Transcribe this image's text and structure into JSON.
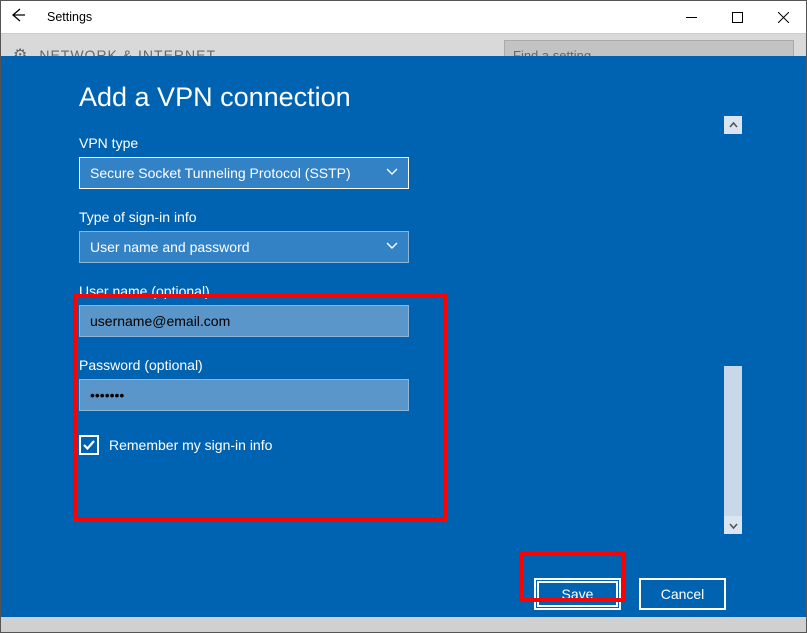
{
  "window": {
    "title": "Settings",
    "bgHeading": "NETWORK & INTERNET",
    "searchPlaceholder": "Find a setting"
  },
  "dialog": {
    "title": "Add a VPN connection",
    "vpnType": {
      "label": "VPN type",
      "value": "Secure Socket Tunneling Protocol (SSTP)"
    },
    "signinType": {
      "label": "Type of sign-in info",
      "value": "User name and password"
    },
    "username": {
      "label": "User name (optional)",
      "value": "username@email.com"
    },
    "password": {
      "label": "Password (optional)",
      "value": "•••••••"
    },
    "remember": {
      "label": "Remember my sign-in info",
      "checked": true
    },
    "save": "Save",
    "cancel": "Cancel"
  }
}
